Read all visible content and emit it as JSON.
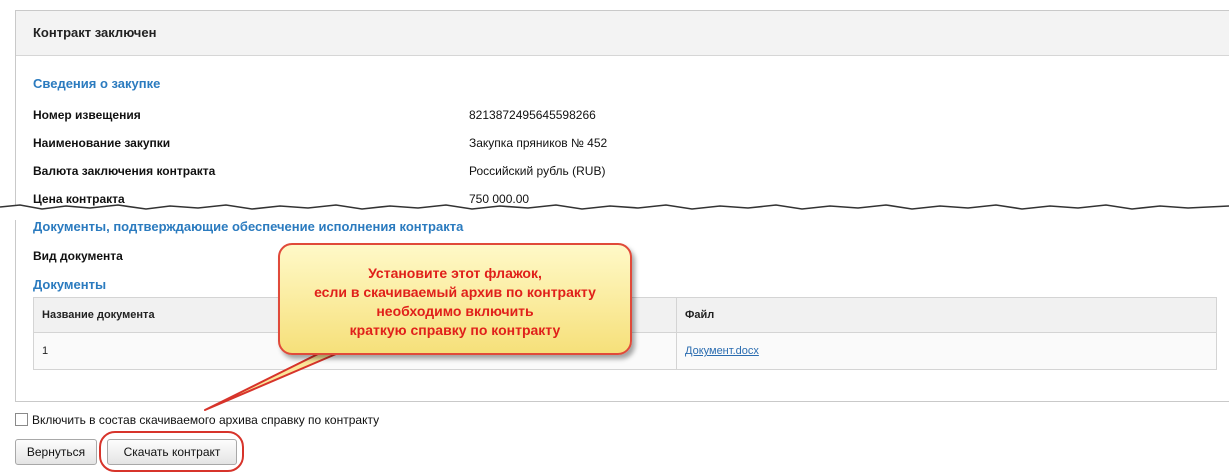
{
  "panel": {
    "title": "Контракт заключен"
  },
  "purchase": {
    "title": "Сведения о закупке",
    "rows": [
      {
        "label": "Номер извещения",
        "value": "8213872495645598266"
      },
      {
        "label": "Наименование закупки",
        "value": "Закупка пряников № 452"
      },
      {
        "label": "Валюта заключения контракта",
        "value": "Российский рубль (RUB)"
      },
      {
        "label": "Цена контракта",
        "value": "750 000.00"
      }
    ]
  },
  "security_docs": {
    "title": "Документы, подтверждающие обеспечение исполнения контракта",
    "doc_type_label": "Вид документа"
  },
  "documents": {
    "title": "Документы",
    "columns": [
      "Название документа",
      "Файл"
    ],
    "rows": [
      {
        "name": "1",
        "file": "Документ.docx"
      }
    ]
  },
  "include_summary": {
    "label": "Включить в состав скачиваемого архива справку по контракту",
    "checked": false
  },
  "buttons": {
    "back": "Вернуться",
    "download": "Скачать контракт"
  },
  "callout": {
    "lines": [
      "Установите этот флажок,",
      "если в скачиваемый архив по контракту",
      "необходимо включить",
      "краткую справку по контракту"
    ]
  }
}
